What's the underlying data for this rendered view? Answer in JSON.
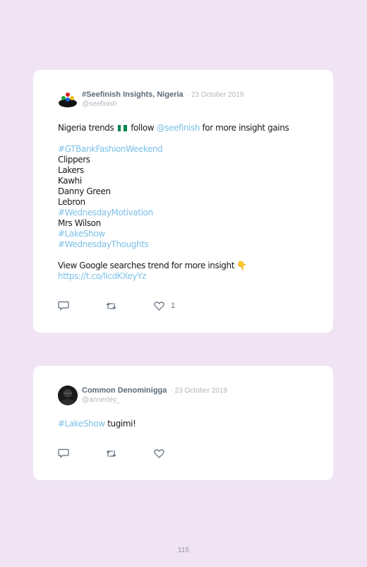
{
  "tweets": [
    {
      "author": "#Seefinish Insights, Nigeria",
      "date": "· 23 October 2019",
      "handle": "@seefinish",
      "lines": {
        "l1_pre": "Nigeria trends",
        "l1_mid": "follow",
        "l1_link": "@seefinish",
        "l1_post": "for more insight gains",
        "l2": "#GTBankFashionWeekend",
        "l3": "Clippers",
        "l4": "Lakers",
        "l5": "Kawhi",
        "l6": "Danny Green",
        "l7": "Lebron",
        "l8": "#WednesdayMotivation",
        "l9": "Mrs Wilson",
        "l10": "#LakeShow",
        "l11": "#WednesdayThoughts",
        "l12_text": "View Google searches trend for more insight",
        "l12_emoji": "👇",
        "l13": "https://t.co/lIcdKXeyYz"
      },
      "flag_colors": [
        "#008751",
        "#ffffff",
        "#008751"
      ],
      "likes": "1",
      "icons": [
        "reply-icon",
        "retweet-icon",
        "like-icon"
      ]
    },
    {
      "author": "Common Denominigga",
      "date": "· 23 October 2019",
      "handle": "@annertey_",
      "lines": {
        "l1_link": "#LakeShow",
        "l1_post": "tugimi!"
      },
      "likes": "",
      "icons": [
        "reply-icon",
        "retweet-icon",
        "like-icon"
      ]
    }
  ],
  "page_number": "115",
  "colors": {
    "background": "#f0e4f4",
    "link": "#7cc0e8",
    "name": "#5c6a78"
  }
}
